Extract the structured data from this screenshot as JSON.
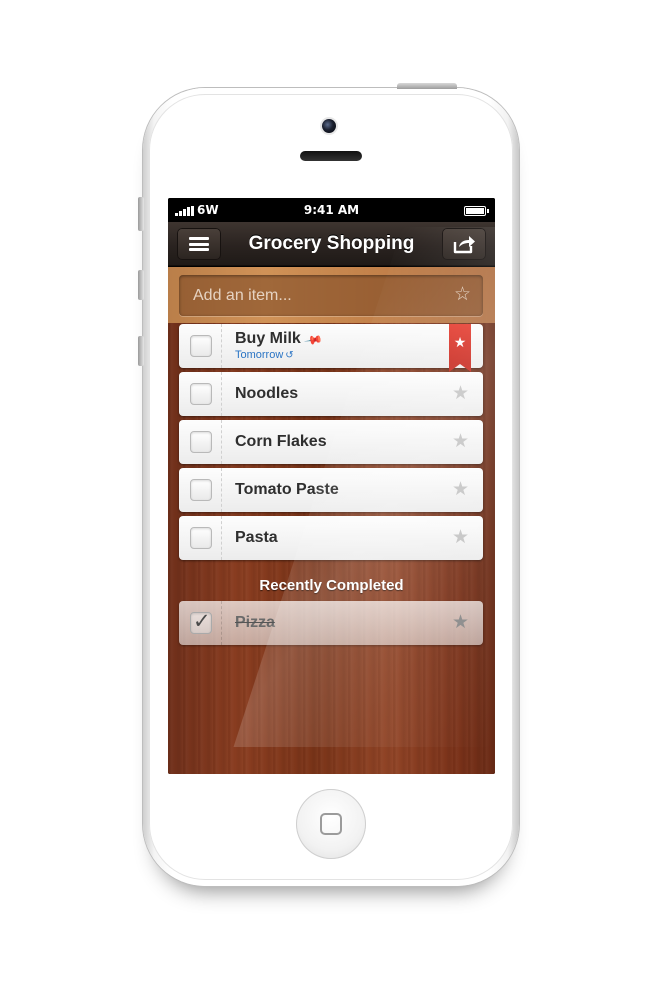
{
  "status_bar": {
    "carrier": "6W",
    "time": "9:41 AM"
  },
  "nav": {
    "title": "Grocery Shopping",
    "menu_icon": "hamburger-menu-icon",
    "share_icon": "share-icon"
  },
  "add_item": {
    "placeholder": "Add an item...",
    "star_icon": "star-outline-icon"
  },
  "tasks": [
    {
      "title": "Buy Milk",
      "due": "Tomorrow",
      "pinned": true,
      "starred": true
    },
    {
      "title": "Noodles",
      "starred": false
    },
    {
      "title": "Corn Flakes",
      "starred": false
    },
    {
      "title": "Tomato Paste",
      "starred": false
    },
    {
      "title": "Pasta",
      "starred": false
    }
  ],
  "completed": {
    "heading": "Recently Completed",
    "items": [
      {
        "title": "Pizza",
        "checked": true
      }
    ]
  },
  "colors": {
    "ribbon": "#d6302a",
    "due_date": "#2a74c4",
    "wood": "#7f3a1d"
  }
}
